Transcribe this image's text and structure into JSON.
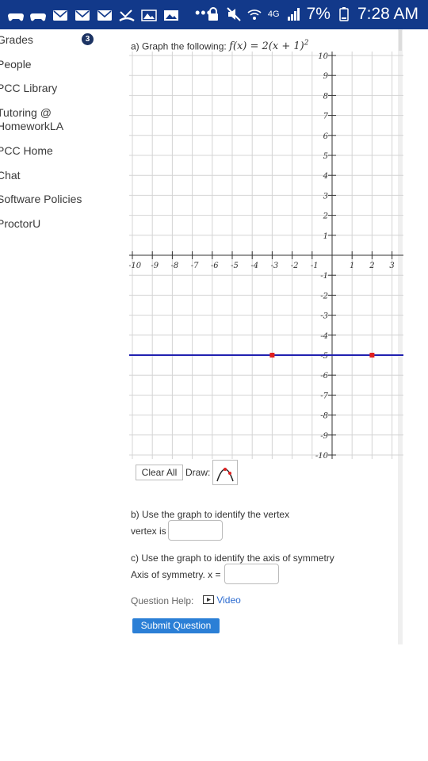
{
  "status_bar": {
    "left_icons": [
      "game-controller-icon",
      "game-controller-icon",
      "mail-icon",
      "mail-icon",
      "mail-icon",
      "missed-call-icon",
      "photo-mail-icon",
      "image-icon"
    ],
    "more": "•••",
    "right_icons": [
      "lock-icon",
      "mute-icon",
      "wifi-icon",
      "4g-icon",
      "signal-icon"
    ],
    "network": "4G",
    "battery_percent": "7%",
    "time": "7:28 AM"
  },
  "sidebar": {
    "items": [
      {
        "label": "Grades"
      },
      {
        "label": "People"
      },
      {
        "label": "PCC Library"
      },
      {
        "label": "Tutoring @\nHomeworkLA"
      },
      {
        "label": "PCC Home"
      },
      {
        "label": "Chat"
      },
      {
        "label": "Software Policies"
      },
      {
        "label": "ProctorU"
      }
    ],
    "grades_badge": "3"
  },
  "question": {
    "part_a_prefix": "a) Graph the following: ",
    "part_a_math": "f(x) = 2(x + 1)",
    "part_a_exp": "2",
    "clear_all": "Clear All",
    "draw_label": "Draw:",
    "draw_tool": "parabola-tool-icon",
    "part_b": "b) Use the graph to identify the vertex",
    "vertex_label": "vertex is",
    "vertex_value": "",
    "part_c": "c) Use the graph to identify the axis of symmetry",
    "axis_label": "Axis of symmetry. x =",
    "axis_value": "",
    "help_label": "Question Help:",
    "video_link": "Video",
    "submit": "Submit Question"
  },
  "chart_data": {
    "type": "line",
    "xlim": [
      -10,
      3
    ],
    "ylim": [
      -10,
      10
    ],
    "x_ticks": [
      -10,
      -9,
      -8,
      -7,
      -6,
      -5,
      -4,
      -3,
      -2,
      -1,
      1,
      2,
      3
    ],
    "y_ticks": [
      10,
      9,
      8,
      7,
      6,
      5,
      4,
      3,
      2,
      1,
      -1,
      -2,
      -3,
      -4,
      -5,
      -6,
      -7,
      -8,
      -9,
      -10
    ],
    "grid": true,
    "drawn_line": {
      "y": -5,
      "color": "#2020b0"
    },
    "points": [
      {
        "x": -3,
        "y": -5
      },
      {
        "x": 2,
        "y": -5
      }
    ],
    "point_color": "#e02020"
  }
}
